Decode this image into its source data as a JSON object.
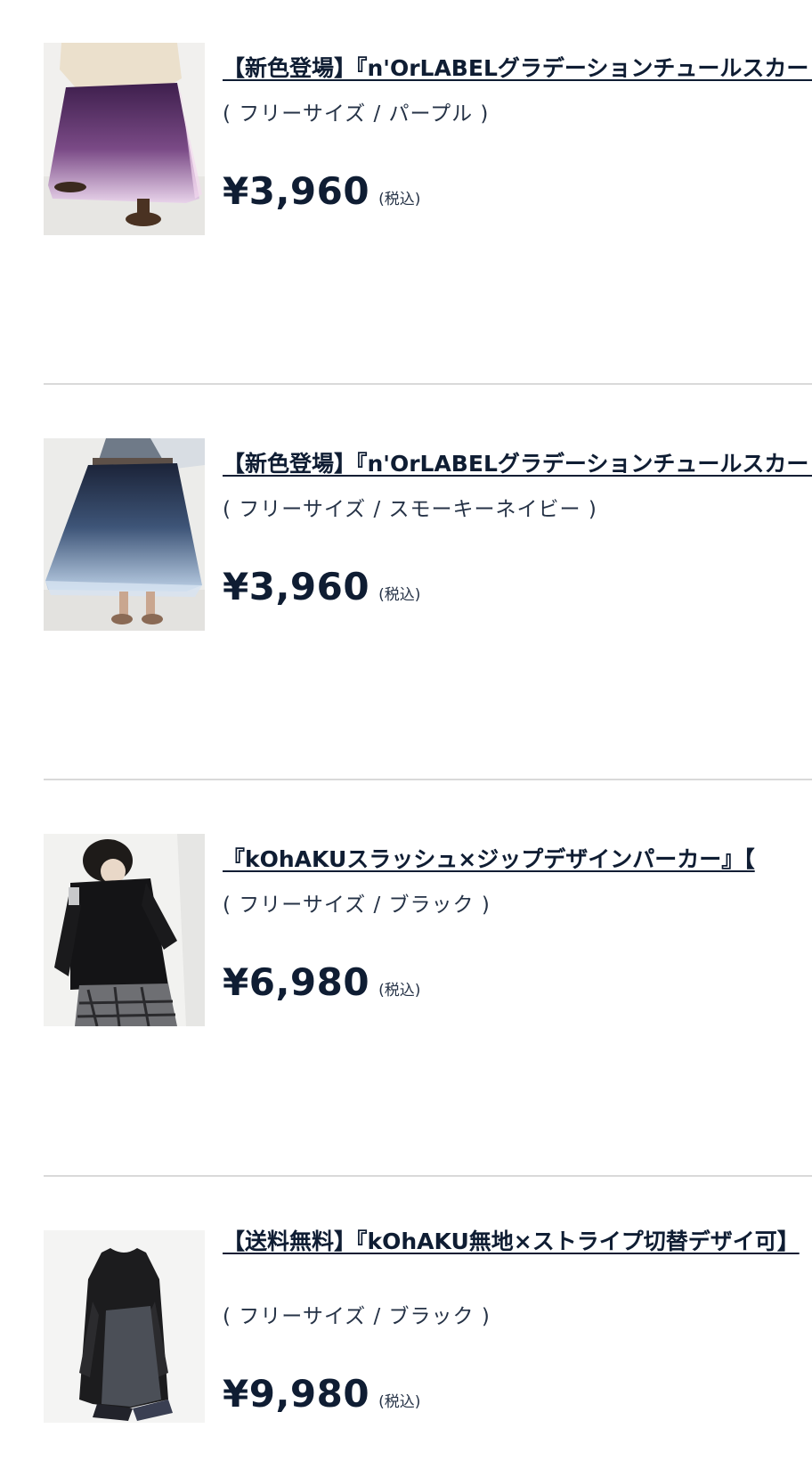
{
  "cart": {
    "items": [
      {
        "title": "【新色登場】『n'OrLABELグラデーションチュールスカート』",
        "variant": "( フリーサイズ / パープル )",
        "price": "¥3,960",
        "tax_label": "(税込)",
        "image": "purple-gradient-tulle-skirt"
      },
      {
        "title": "【新色登場】『n'OrLABELグラデーションチュールスカート』",
        "variant": "( フリーサイズ / スモーキーネイビー )",
        "price": "¥3,960",
        "tax_label": "(税込)",
        "image": "navy-gradient-tulle-skirt"
      },
      {
        "title": "『kOhAKUスラッシュ×ジップデザインパーカー』【",
        "variant": "( フリーサイズ / ブラック )",
        "price": "¥6,980",
        "tax_label": "(税込)",
        "image": "black-zip-hoodie"
      },
      {
        "title": "【送料無料】『kOhAKU無地×ストライプ切替デザイ可】",
        "variant": "( フリーサイズ / ブラック )",
        "price": "¥9,980",
        "tax_label": "(税込)",
        "image": "black-stripe-panel-dress"
      }
    ]
  },
  "colors": {
    "text": "#0f1d33",
    "divider": "#d9d9d9"
  }
}
